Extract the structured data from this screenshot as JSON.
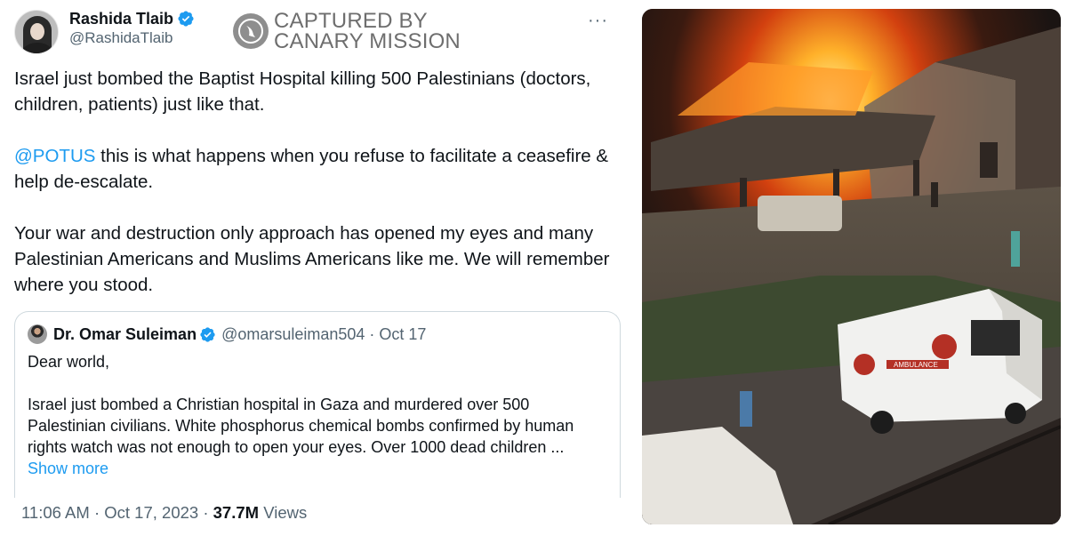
{
  "tweet": {
    "author_name": "Rashida Tlaib",
    "author_handle": "@RashidaTlaib",
    "paragraphs": [
      "Israel just bombed the Baptist Hospital killing 500 Palestinians (doctors, children, patients) just like that.",
      " this is what happens when you refuse to facilitate a ceasefire & help de-escalate.",
      "Your war and destruction only approach has opened my eyes and many Palestinian Americans and Muslims Americans like me. We will remember where you stood."
    ],
    "mention": "@POTUS",
    "time": "11:06 AM",
    "date": "Oct 17, 2023",
    "views_count": "37.7M",
    "views_label": "Views",
    "separator": "·"
  },
  "watermark": {
    "line1": "CAPTURED BY",
    "line2": "CANARY MISSION"
  },
  "more_menu": "···",
  "quote": {
    "author_name": "Dr. Omar Suleiman",
    "author_handle": "@omarsuleiman504",
    "date": "Oct 17",
    "separator": "·",
    "greeting": "Dear world,",
    "body": "Israel just bombed a Christian hospital in Gaza and murdered over 500 Palestinian civilians. White phosphorus chemical bombs confirmed by human rights watch was not enough to open your eyes. Over 1000 dead children ...",
    "show_more": "Show more"
  },
  "photo": {
    "ambulance_text": "AMBULANCE"
  },
  "colors": {
    "link": "#1d9bf0",
    "secondary_text": "#536471",
    "primary_text": "#0f1419",
    "verified": "#1d9bf0",
    "border": "#cfd9de"
  },
  "icons": [
    "verified-badge-icon",
    "more-options-icon",
    "canary-mission-logo-icon"
  ]
}
